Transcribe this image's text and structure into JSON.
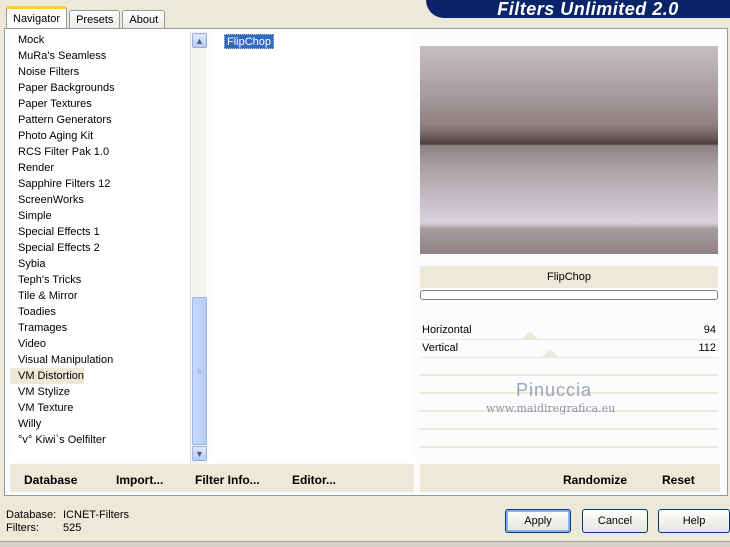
{
  "tabs": [
    "Navigator",
    "Presets",
    "About"
  ],
  "banner_title": "Filters Unlimited 2.0",
  "categories": [
    "Mock",
    "MuRa's Seamless",
    "Noise Filters",
    "Paper Backgrounds",
    "Paper Textures",
    "Pattern Generators",
    "Photo Aging Kit",
    "RCS Filter Pak 1.0",
    "Render",
    "Sapphire Filters 12",
    "ScreenWorks",
    "Simple",
    "Special Effects 1",
    "Special Effects 2",
    "Sybia",
    "Teph's Tricks",
    "Tile & Mirror",
    "Toadies",
    "Tramages",
    "Video",
    "Visual Manipulation",
    "VM Distortion",
    "VM Stylize",
    "VM Texture",
    "Willy",
    "°v° Kiwi`s Oelfilter"
  ],
  "selected_category": "VM Distortion",
  "filters": [
    "FlipChop"
  ],
  "selected_filter_name": "FlipChop",
  "params": [
    {
      "label": "Horizontal",
      "value": "94"
    },
    {
      "label": "Vertical",
      "value": "112"
    }
  ],
  "watermark": {
    "name": "Pinuccia",
    "site": "www.maidiregrafica.eu"
  },
  "left_buttons": {
    "database": "Database",
    "import": "Import...",
    "filter_info": "Filter Info...",
    "editor": "Editor..."
  },
  "right_buttons": {
    "randomize": "Randomize",
    "reset": "Reset"
  },
  "status": {
    "database_label": "Database:",
    "database_value": "ICNET-Filters",
    "filters_label": "Filters:",
    "filters_value": "525"
  },
  "dialog_buttons": {
    "apply": "Apply",
    "cancel": "Cancel",
    "help": "Help"
  }
}
